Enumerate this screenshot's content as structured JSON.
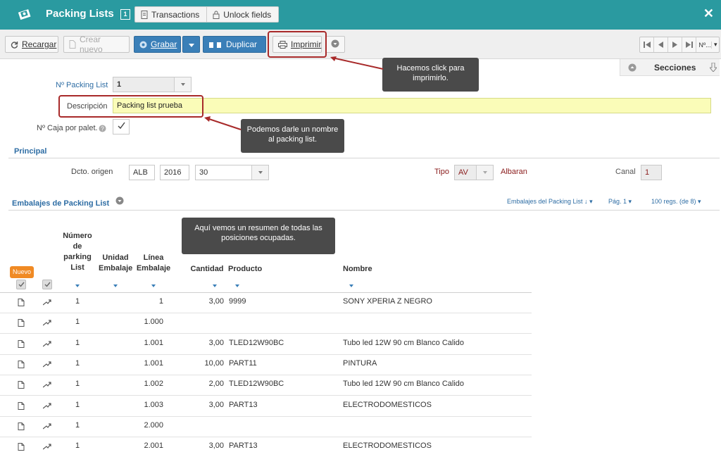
{
  "window": {
    "title": "Packing Lists",
    "title_number": "1",
    "tabs": [
      "Transactions",
      "Unlock fields"
    ],
    "close_symbol": "✕"
  },
  "toolbar": {
    "reload": "Recargar",
    "create_new": "Crear nuevo",
    "save": "Grabar",
    "duplicate": "Duplicar",
    "print": "Imprimir",
    "record_selector": "Nº..."
  },
  "callouts": {
    "print": "Hacemos click para imprimirlo.",
    "description": "Podemos darle un nombre al packing list.",
    "summary": "Aquí vemos un resumen de todas las posiciones ocupadas."
  },
  "sections_panel": {
    "label": "Secciones"
  },
  "form": {
    "packing_list_no_label": "Nº Packing List",
    "packing_list_no_value": "1",
    "description_label": "Descripción",
    "description_value": "Packing list prueba",
    "boxes_per_pallet_label": "Nº Caja por palet.",
    "boxes_per_pallet_checked": true
  },
  "principal": {
    "title": "Principal",
    "doc_origin_label": "Dcto. origen",
    "doc_type": "ALB",
    "doc_year": "2016",
    "doc_number": "30",
    "tipo_label": "Tipo",
    "tipo_value": "AV",
    "tipo_desc": "Albaran",
    "canal_label": "Canal",
    "canal_value": "1"
  },
  "packing_section": {
    "title": "Embalajes de Packing List",
    "sort_label": "Embalajes del Packing List ↓",
    "page_label": "Pág. 1",
    "records_label": "100 regs. (de 8)",
    "new_badge": "Nuevo"
  },
  "table": {
    "headers": {
      "numero": "Número de parking List",
      "unidad": "Unidad Embalaje",
      "linea": "Línea Embalaje",
      "cantidad": "Cantidad",
      "producto": "Producto",
      "nombre": "Nombre"
    },
    "rows": [
      {
        "numero": "1",
        "linea": "1",
        "cantidad": "3,00",
        "producto": "9999",
        "nombre": "SONY XPERIA Z NEGRO"
      },
      {
        "numero": "1",
        "linea": "1.000",
        "cantidad": "",
        "producto": "",
        "nombre": ""
      },
      {
        "numero": "1",
        "linea": "1.001",
        "cantidad": "3,00",
        "producto": "TLED12W90BC",
        "nombre": "Tubo led 12W 90 cm Blanco Calido"
      },
      {
        "numero": "1",
        "linea": "1.001",
        "cantidad": "10,00",
        "producto": "PART11",
        "nombre": "PINTURA"
      },
      {
        "numero": "1",
        "linea": "1.002",
        "cantidad": "2,00",
        "producto": "TLED12W90BC",
        "nombre": "Tubo led 12W 90 cm Blanco Calido"
      },
      {
        "numero": "1",
        "linea": "1.003",
        "cantidad": "3,00",
        "producto": "PART13",
        "nombre": "ELECTRODOMESTICOS"
      },
      {
        "numero": "1",
        "linea": "2.000",
        "cantidad": "",
        "producto": "",
        "nombre": ""
      },
      {
        "numero": "1",
        "linea": "2.001",
        "cantidad": "3,00",
        "producto": "PART13",
        "nombre": "ELECTRODOMESTICOS"
      }
    ]
  },
  "colors": {
    "titlebar": "#2a9aa0",
    "primary_button": "#3a7fb8",
    "highlight": "#a82a2a",
    "callout": "#4a4a4a",
    "badge": "#f08a24",
    "description_bg": "#fafcb8"
  }
}
